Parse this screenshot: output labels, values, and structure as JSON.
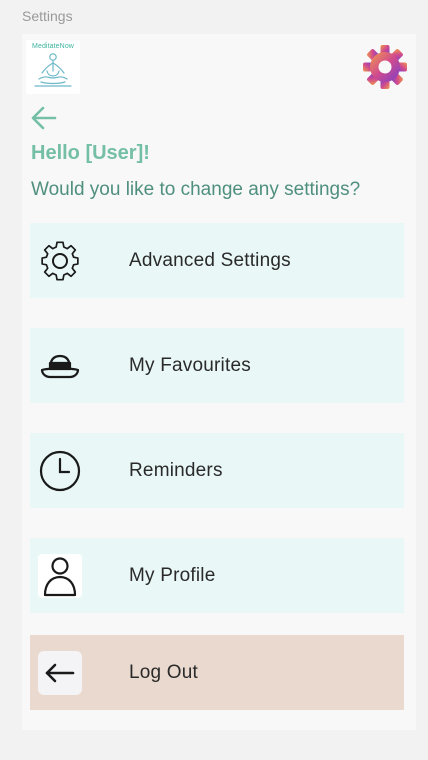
{
  "frame": {
    "label": "Settings"
  },
  "header": {
    "logo_text": "MeditateNow",
    "greeting": "Hello [User]!",
    "subtitle": "Would you like to change any settings?"
  },
  "menu": [
    {
      "label": "Advanced Settings",
      "icon": "gear-outline-icon"
    },
    {
      "label": "My Favourites",
      "icon": "hat-icon"
    },
    {
      "label": "Reminders",
      "icon": "clock-icon"
    },
    {
      "label": "My Profile",
      "icon": "person-icon"
    },
    {
      "label": "Log Out",
      "icon": "arrow-left-icon"
    }
  ],
  "colors": {
    "accent": "#74bfa6",
    "subtitle": "#4e8f7e",
    "menu_bg": "#e9f7f7",
    "logout_bg": "#ead9cf"
  }
}
